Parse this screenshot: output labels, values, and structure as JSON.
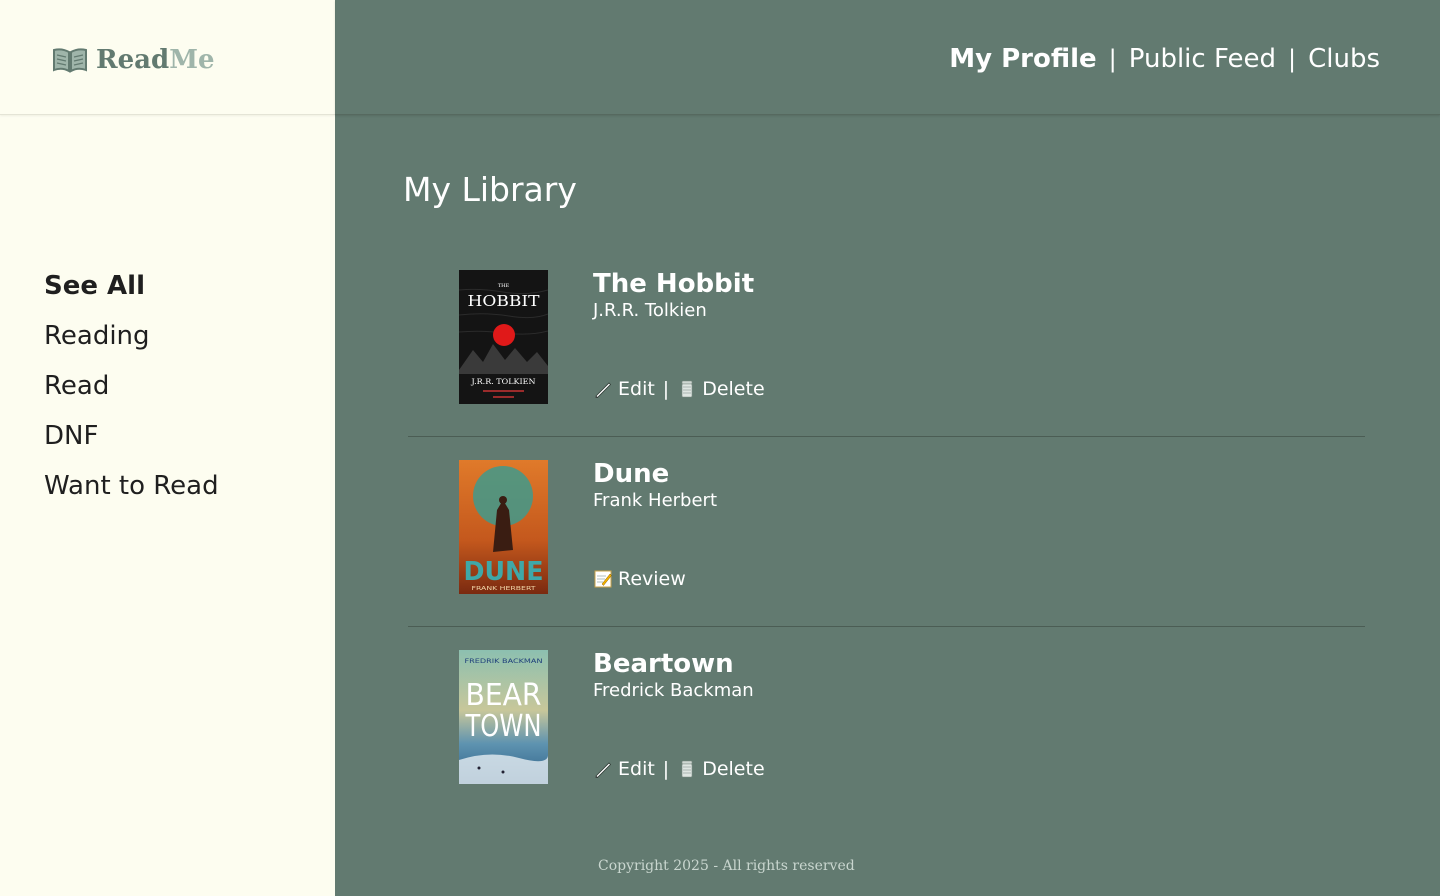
{
  "brand": {
    "name_part1": "Read",
    "name_part2": "Me",
    "icon": "open-book-icon",
    "color_primary": "#627a70",
    "color_secondary": "#9fb5aa"
  },
  "top_nav": {
    "items": [
      {
        "label": "My Profile",
        "active": true
      },
      {
        "label": "Public Feed",
        "active": false
      },
      {
        "label": "Clubs",
        "active": false
      }
    ],
    "separator": "|"
  },
  "sidebar": {
    "items": [
      {
        "label": "See All",
        "active": true
      },
      {
        "label": "Reading",
        "active": false
      },
      {
        "label": "Read",
        "active": false
      },
      {
        "label": "DNF",
        "active": false
      },
      {
        "label": "Want to Read",
        "active": false
      }
    ]
  },
  "page_title": "My Library",
  "books": [
    {
      "title": "The Hobbit",
      "author": "J.R.R. Tolkien",
      "cover": {
        "top_text": "THE",
        "title_text": "HOBBIT",
        "author_text": "J.R.R. TOLKIEN",
        "bg": "#121212"
      },
      "actions": [
        {
          "label": "Edit",
          "icon": "pencil-icon"
        },
        {
          "label": "Delete",
          "icon": "trash-icon"
        }
      ]
    },
    {
      "title": "Dune",
      "author": "Frank Herbert",
      "cover": {
        "title_text": "DUNE",
        "author_text": "FRANK HERBERT",
        "bg": "#c4581d"
      },
      "actions": [
        {
          "label": "Review",
          "icon": "memo-icon"
        }
      ]
    },
    {
      "title": "Beartown",
      "author": "Fredrick Backman",
      "cover": {
        "top_text": "FREDRIK BACKMAN",
        "title_line1": "BEAR",
        "title_line2": "TOWN",
        "bg": "#8fb4a6"
      },
      "actions": [
        {
          "label": "Edit",
          "icon": "pencil-icon"
        },
        {
          "label": "Delete",
          "icon": "trash-icon"
        }
      ]
    }
  ],
  "footer": "Copyright 2025 - All rights reserved",
  "colors": {
    "main_bg": "#627a70",
    "sidebar_bg": "#fdfdf0",
    "divider": "#4b5d54"
  }
}
